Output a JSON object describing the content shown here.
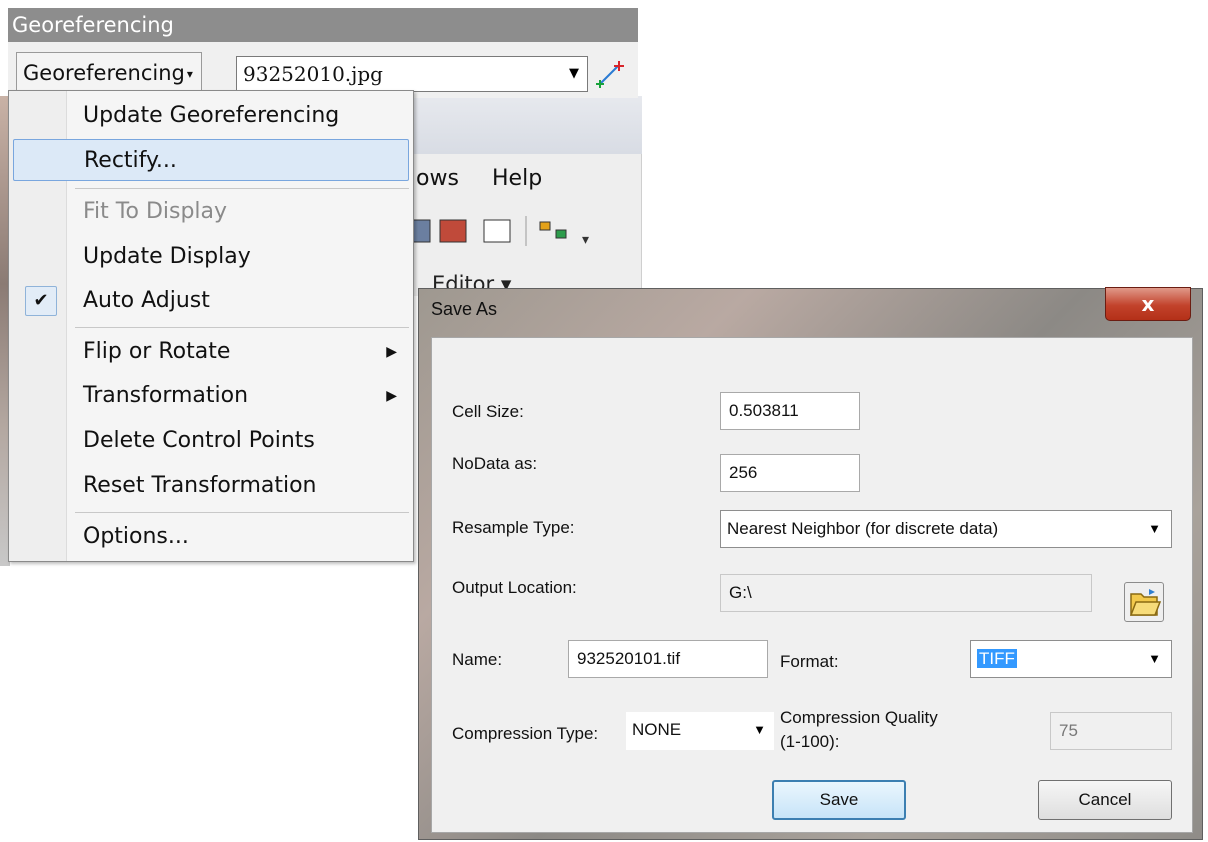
{
  "toolbar": {
    "title": "Georeferencing",
    "menu_button_label": "Georeferencing",
    "layer_select_value": "93252010.jpg",
    "add_control_points_icon": "add-control-points-icon"
  },
  "background_window": {
    "menu_partial_windows": "ows",
    "menu_help": "Help",
    "editor_label": "Editor"
  },
  "menu": {
    "items": [
      {
        "label": "Update Georeferencing"
      },
      {
        "label": "Rectify..."
      },
      {
        "label": "Fit To Display"
      },
      {
        "label": "Update Display"
      },
      {
        "label": "Auto Adjust",
        "checked": true
      },
      {
        "label": "Flip or Rotate"
      },
      {
        "label": "Transformation"
      },
      {
        "label": "Delete Control Points"
      },
      {
        "label": "Reset Transformation"
      },
      {
        "label": "Options..."
      }
    ],
    "highlighted": "Rectify...",
    "disabled": "Fit To Display",
    "check_mark": "✔"
  },
  "dialog": {
    "title": "Save As",
    "close_label": "x",
    "cell_size_label": "Cell Size:",
    "cell_size_value": "0.503811",
    "nodata_label": "NoData as:",
    "nodata_value": "256",
    "resample_label": "Resample Type:",
    "resample_value": "Nearest Neighbor (for discrete data)",
    "output_location_label": "Output Location:",
    "output_location_value": "G:\\",
    "name_label": "Name:",
    "name_value": "932520101.tif",
    "format_label": "Format:",
    "format_value": "TIFF",
    "compression_type_label": "Compression Type:",
    "compression_type_value": "NONE",
    "compression_quality_label_line1": "Compression Quality",
    "compression_quality_label_line2": "(1-100):",
    "compression_quality_value": "75",
    "save_label": "Save",
    "cancel_label": "Cancel"
  },
  "colors": {
    "menu_highlight": "#dce9f7",
    "title_bar": "#8d8d8d",
    "close_button": "#c2422b",
    "selection": "#3399ff"
  }
}
